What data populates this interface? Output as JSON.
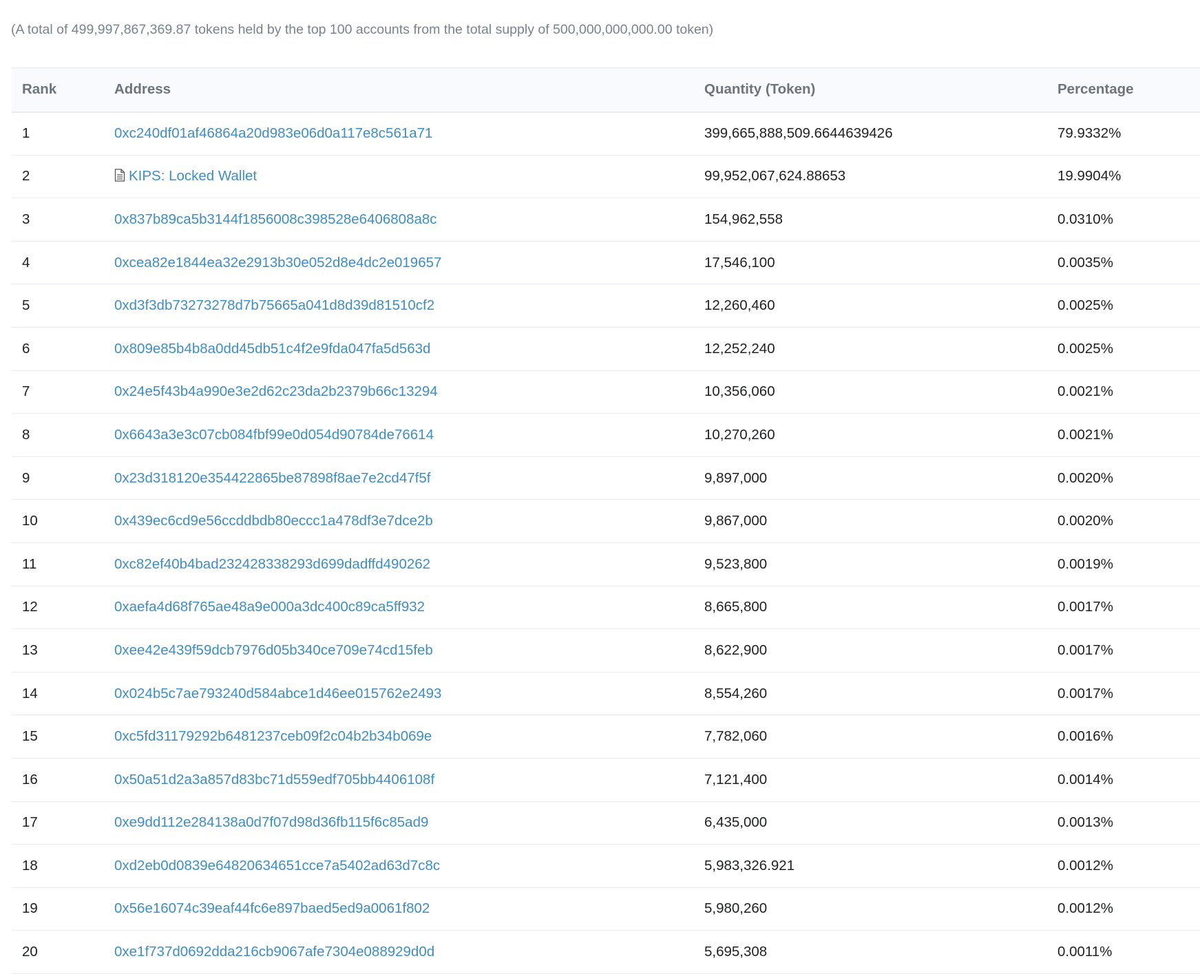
{
  "summary": "(A total of 499,997,867,369.87 tokens held by the top 100 accounts from the total supply of 500,000,000,000.00 token)",
  "table": {
    "headers": {
      "rank": "Rank",
      "address": "Address",
      "quantity": "Quantity (Token)",
      "percentage": "Percentage"
    },
    "rows": [
      {
        "rank": "1",
        "address": "0xc240df01af46864a20d983e06d0a117e8c561a71",
        "quantity": "399,665,888,509.6644639426",
        "percentage": "79.9332%",
        "icon": ""
      },
      {
        "rank": "2",
        "address": "KIPS: Locked Wallet",
        "quantity": "99,952,067,624.88653",
        "percentage": "19.9904%",
        "icon": "contract-document-icon"
      },
      {
        "rank": "3",
        "address": "0x837b89ca5b3144f1856008c398528e6406808a8c",
        "quantity": "154,962,558",
        "percentage": "0.0310%",
        "icon": ""
      },
      {
        "rank": "4",
        "address": "0xcea82e1844ea32e2913b30e052d8e4dc2e019657",
        "quantity": "17,546,100",
        "percentage": "0.0035%",
        "icon": ""
      },
      {
        "rank": "5",
        "address": "0xd3f3db73273278d7b75665a041d8d39d81510cf2",
        "quantity": "12,260,460",
        "percentage": "0.0025%",
        "icon": ""
      },
      {
        "rank": "6",
        "address": "0x809e85b4b8a0dd45db51c4f2e9fda047fa5d563d",
        "quantity": "12,252,240",
        "percentage": "0.0025%",
        "icon": ""
      },
      {
        "rank": "7",
        "address": "0x24e5f43b4a990e3e2d62c23da2b2379b66c13294",
        "quantity": "10,356,060",
        "percentage": "0.0021%",
        "icon": ""
      },
      {
        "rank": "8",
        "address": "0x6643a3e3c07cb084fbf99e0d054d90784de76614",
        "quantity": "10,270,260",
        "percentage": "0.0021%",
        "icon": ""
      },
      {
        "rank": "9",
        "address": "0x23d318120e354422865be87898f8ae7e2cd47f5f",
        "quantity": "9,897,000",
        "percentage": "0.0020%",
        "icon": ""
      },
      {
        "rank": "10",
        "address": "0x439ec6cd9e56ccddbdb80eccc1a478df3e7dce2b",
        "quantity": "9,867,000",
        "percentage": "0.0020%",
        "icon": ""
      },
      {
        "rank": "11",
        "address": "0xc82ef40b4bad232428338293d699dadffd490262",
        "quantity": "9,523,800",
        "percentage": "0.0019%",
        "icon": ""
      },
      {
        "rank": "12",
        "address": "0xaefa4d68f765ae48a9e000a3dc400c89ca5ff932",
        "quantity": "8,665,800",
        "percentage": "0.0017%",
        "icon": ""
      },
      {
        "rank": "13",
        "address": "0xee42e439f59dcb7976d05b340ce709e74cd15feb",
        "quantity": "8,622,900",
        "percentage": "0.0017%",
        "icon": ""
      },
      {
        "rank": "14",
        "address": "0x024b5c7ae793240d584abce1d46ee015762e2493",
        "quantity": "8,554,260",
        "percentage": "0.0017%",
        "icon": ""
      },
      {
        "rank": "15",
        "address": "0xc5fd31179292b6481237ceb09f2c04b2b34b069e",
        "quantity": "7,782,060",
        "percentage": "0.0016%",
        "icon": ""
      },
      {
        "rank": "16",
        "address": "0x50a51d2a3a857d83bc71d559edf705bb4406108f",
        "quantity": "7,121,400",
        "percentage": "0.0014%",
        "icon": ""
      },
      {
        "rank": "17",
        "address": "0xe9dd112e284138a0d7f07d98d36fb115f6c85ad9",
        "quantity": "6,435,000",
        "percentage": "0.0013%",
        "icon": ""
      },
      {
        "rank": "18",
        "address": "0xd2eb0d0839e64820634651cce7a5402ad63d7c8c",
        "quantity": "5,983,326.921",
        "percentage": "0.0012%",
        "icon": ""
      },
      {
        "rank": "19",
        "address": "0x56e16074c39eaf44fc6e897baed5ed9a0061f802",
        "quantity": "5,980,260",
        "percentage": "0.0012%",
        "icon": ""
      },
      {
        "rank": "20",
        "address": "0xe1f737d0692dda216cb9067afe7304e088929d0d",
        "quantity": "5,695,308",
        "percentage": "0.0011%",
        "icon": ""
      }
    ]
  }
}
